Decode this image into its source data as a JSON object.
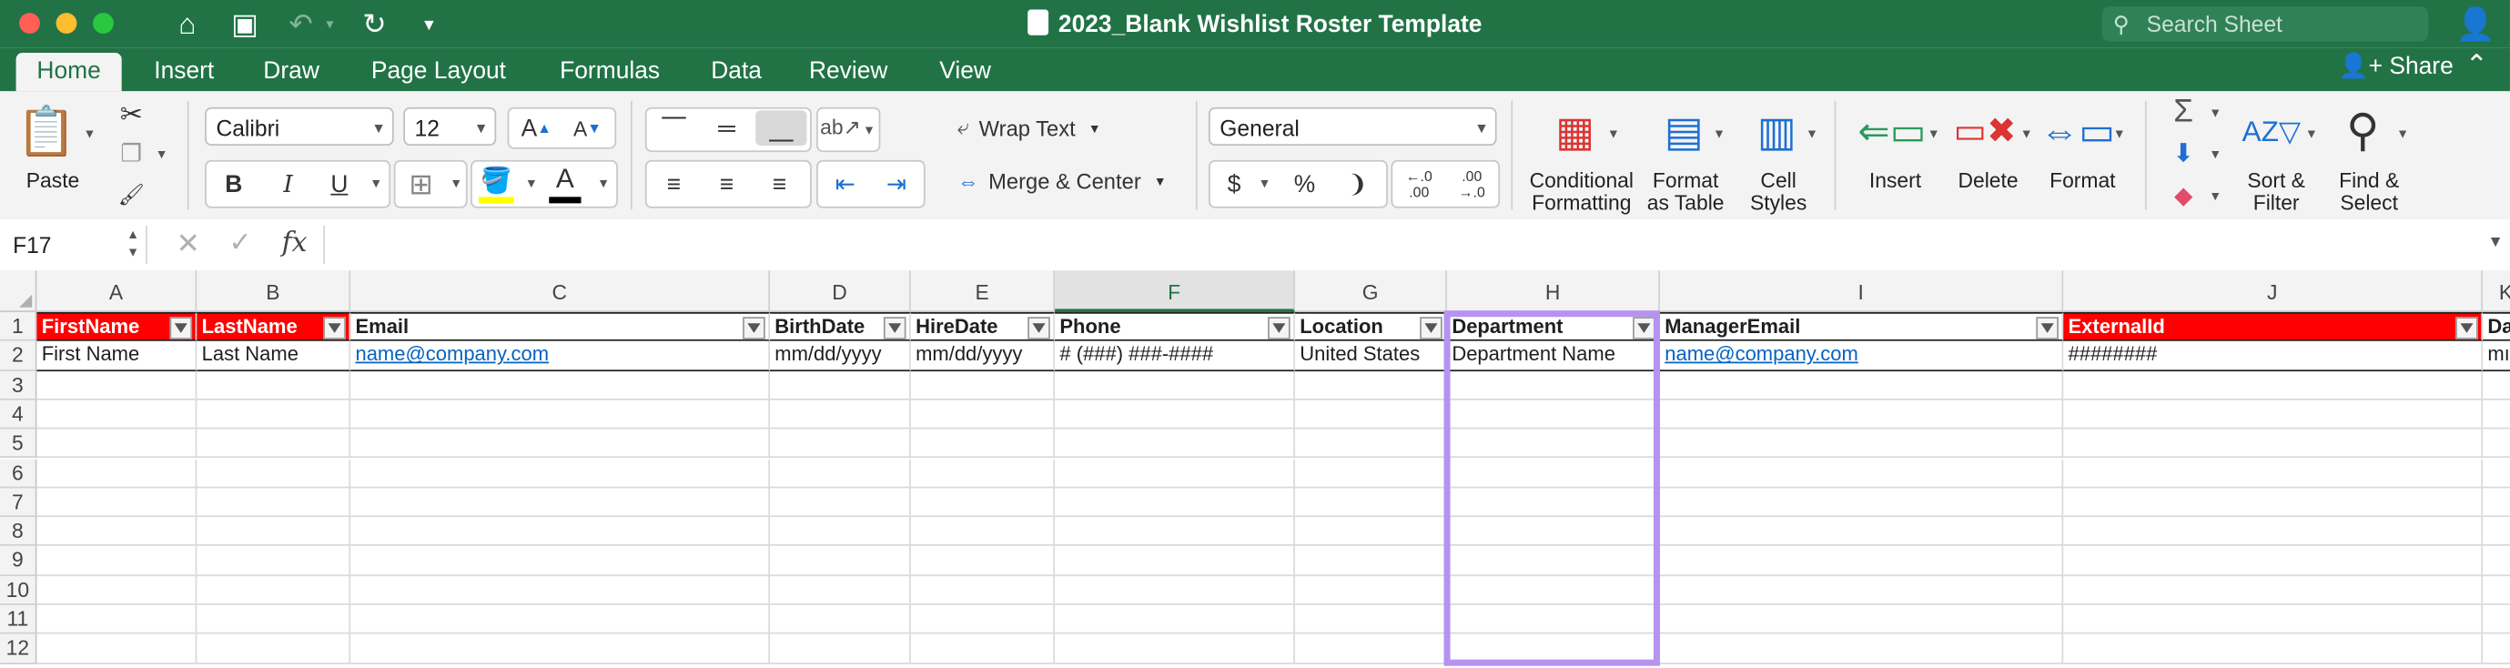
{
  "window": {
    "title": "2023_Blank Wishlist Roster Template",
    "search_placeholder": "Search Sheet"
  },
  "ribbon_tabs": [
    "Home",
    "Insert",
    "Draw",
    "Page Layout",
    "Formulas",
    "Data",
    "Review",
    "View"
  ],
  "active_tab": "Home",
  "share_label": "Share",
  "ribbon": {
    "paste_label": "Paste",
    "font_name": "Calibri",
    "font_size": "12",
    "wrap_text_label": "Wrap Text",
    "merge_center_label": "Merge & Center",
    "number_format": "General",
    "conditional_formatting": [
      "Conditional",
      "Formatting"
    ],
    "format_as_table": [
      "Format",
      "as Table"
    ],
    "cell_styles": [
      "Cell",
      "Styles"
    ],
    "insert_label": "Insert",
    "delete_label": "Delete",
    "format_label": "Format",
    "sort_filter": [
      "Sort &",
      "Filter"
    ],
    "find_select": [
      "Find &",
      "Select"
    ],
    "bold": "B",
    "italic": "I",
    "underline": "U",
    "currency": "$",
    "percent": "%",
    "comma": "❩",
    "inc_decimal": "←.0 .00",
    "dec_decimal": ".00 →.0"
  },
  "formula_bar": {
    "name_box": "F17",
    "fx": "fx",
    "formula": ""
  },
  "colors": {
    "brand_green": "#217346",
    "header_red": "#ff0000",
    "highlight_purple": "#b693f0",
    "link_blue": "#0563c1"
  },
  "sheet": {
    "selected_column": "F",
    "columns": [
      "A",
      "B",
      "C",
      "D",
      "E",
      "F",
      "G",
      "H",
      "I",
      "J",
      "K"
    ],
    "row_numbers": [
      "1",
      "2",
      "3",
      "4",
      "5",
      "6",
      "7",
      "8",
      "9",
      "10",
      "11",
      "12"
    ],
    "headers": [
      "FirstName",
      "LastName",
      "Email",
      "BirthDate",
      "HireDate",
      "Phone",
      "Location",
      "Department",
      "ManagerEmail",
      "ExternalId",
      "Da"
    ],
    "red_header_columns": [
      "A",
      "B",
      "J"
    ],
    "row2": [
      "First Name",
      "Last Name",
      "name@company.com",
      "mm/dd/yyyy",
      "mm/dd/yyyy",
      "# (###) ###-####",
      "United States",
      "Department Name",
      "name@company.com",
      "########",
      "mı"
    ],
    "link_columns": [
      "C",
      "I"
    ],
    "highlighted_column": "H"
  }
}
